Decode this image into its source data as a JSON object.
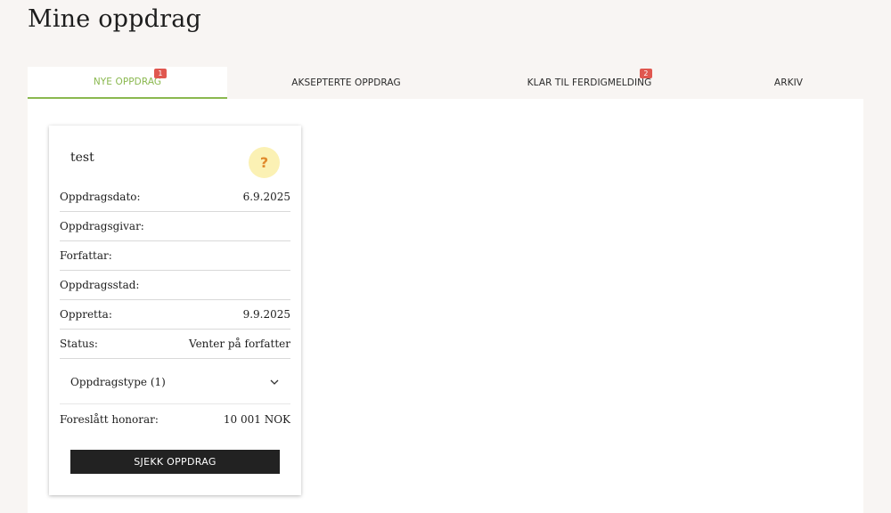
{
  "page": {
    "title": "Mine oppdrag"
  },
  "tabs": [
    {
      "label": "NYE OPPDRAG",
      "badge": "1",
      "active": true
    },
    {
      "label": "AKSEPTERTE OPPDRAG",
      "badge": null,
      "active": false
    },
    {
      "label": "KLAR TIL FERDIGMELDING",
      "badge": "2",
      "active": false
    },
    {
      "label": "ARKIV",
      "badge": null,
      "active": false
    }
  ],
  "card": {
    "title": "test",
    "status_icon": {
      "glyph": "?",
      "name": "question-icon"
    },
    "rows": [
      {
        "label": "Oppdragsdato:",
        "value": "6.9.2025"
      },
      {
        "label": "Oppdragsgivar:",
        "value": ""
      },
      {
        "label": "Forfattar:",
        "value": ""
      },
      {
        "label": "Oppdragsstad:",
        "value": ""
      },
      {
        "label": "Oppretta:",
        "value": "9.9.2025"
      },
      {
        "label": "Status:",
        "value": "Venter på forfatter"
      }
    ],
    "expander": {
      "label": "Oppdragstype (1)"
    },
    "fee": {
      "label": "Foreslått honorar:",
      "value": "10 001 NOK"
    },
    "button": {
      "label": "SJEKK OPPDRAG"
    }
  },
  "colors": {
    "accent_green": "#8ab84f",
    "badge_red": "#e0574f",
    "status_icon_bg": "#fbf1b4",
    "status_icon_fg": "#e08a2c",
    "button_bg": "#222222"
  }
}
